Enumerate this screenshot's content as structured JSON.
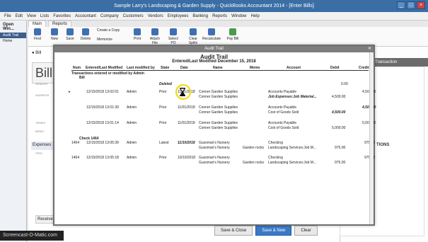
{
  "window": {
    "title": "Sample Larry's Landscaping & Garden Supply  - QuickBooks Accountant 2014 - [Enter Bills]"
  },
  "menu": [
    "File",
    "Edit",
    "View",
    "Lists",
    "Favorites",
    "Accountant",
    "Company",
    "Customers",
    "Vendors",
    "Employees",
    "Banking",
    "Reports",
    "Window",
    "Help"
  ],
  "leftnav": {
    "header": "Open Win...",
    "items": [
      "Audit Trail",
      "Home"
    ]
  },
  "tabs": [
    "Main",
    "Reports"
  ],
  "toolbar": [
    "Find",
    "New",
    "Save",
    "Delete",
    "Create a Copy",
    "Memorize",
    "Print",
    "Attach File",
    "Select PO",
    "Clear Splits",
    "Recalculate",
    "Pay Bill"
  ],
  "form": {
    "type_label": "Bill",
    "title": "Bill",
    "labels": [
      "VENDOR",
      "ADDRESS",
      "TERMS",
      "MEMO"
    ],
    "expenses_tab": "Expenses",
    "item_label": "ITEM",
    "receive_btn": "Receive"
  },
  "rightpanel": {
    "header": "Transaction",
    "label": "TIONS"
  },
  "bottom": {
    "save_close": "Save & Close",
    "save_new": "Save & New",
    "clear": "Clear"
  },
  "watermark": "Screencast-O-Matic.com",
  "dialog": {
    "title": "Audit Trail",
    "report_title": "Entered/Last Modified December 15, 2018",
    "columns": [
      "Num",
      "Entered/Last Modified",
      "Last modified by",
      "State",
      "Date",
      "Name",
      "Memo",
      "Account",
      "Debit",
      "Credit"
    ],
    "section": "Transactions entered or modified by Admin",
    "subsection": "Bill",
    "deleted_label": "Deleted",
    "deleted_debit": "0.00",
    "rows": [
      {
        "arrow": "▸",
        "num": "",
        "entered": "12/15/2018 13:02:01",
        "by": "Admin",
        "state": "Prior",
        "date": "11/01/2018",
        "names": [
          "Conner Garden Supplies",
          "Conner Garden Supplies"
        ],
        "memo": [
          "",
          ""
        ],
        "accounts": [
          "Accounts Payable",
          "Job Expenses:Job Material..."
        ],
        "debits": [
          "",
          "4,500.00"
        ],
        "credits": [
          "4,500.00",
          ""
        ]
      },
      {
        "arrow": "",
        "num": "",
        "entered": "12/15/2018 13:01:39",
        "by": "Admin",
        "state": "Prior",
        "date": "11/01/2018",
        "names": [
          "Conner Garden Supplies",
          "Conner Garden Supplies"
        ],
        "memo": [
          "",
          ""
        ],
        "accounts": [
          "Accounts Payable",
          "Cost of Goods Sold"
        ],
        "debits": [
          "",
          "4,500.00"
        ],
        "credits": [
          "4,500.00",
          ""
        ]
      },
      {
        "arrow": "",
        "num": "",
        "entered": "12/15/2018 13:01:14",
        "by": "Admin",
        "state": "Prior",
        "date": "11/01/2018",
        "names": [
          "Conner Garden Supplies",
          "Conner Garden Supplies"
        ],
        "memo": [
          "",
          ""
        ],
        "accounts": [
          "Accounts Payable",
          "Cost of Goods Sold"
        ],
        "debits": [
          "",
          "5,000.00"
        ],
        "credits": [
          "5,000.00",
          ""
        ]
      }
    ],
    "check_label": "Check 1464",
    "checks": [
      {
        "num": "1464",
        "entered": "12/15/2018 13:05:39",
        "by": "Admin",
        "state": "Latest",
        "date": "11/10/2018",
        "names": [
          "Gussman's Nursery",
          "Gussman's Nursery"
        ],
        "memo": [
          "",
          "Garden rocks"
        ],
        "accounts": [
          "Checking",
          "Landscaping Services:Job M..."
        ],
        "debits": [
          "",
          "975.00"
        ],
        "credits": [
          "975.00",
          ""
        ]
      },
      {
        "num": "1464",
        "entered": "12/15/2018 13:05:18",
        "by": "Admin",
        "state": "Prior",
        "date": "10/10/2018",
        "names": [
          "Gussman's Nursery",
          "Gussman's Nursery"
        ],
        "memo": [
          "",
          "Garden rocks"
        ],
        "accounts": [
          "Checking",
          "Landscaping Services:Job M..."
        ],
        "debits": [
          "",
          "975.00"
        ],
        "credits": [
          "975.00",
          ""
        ]
      }
    ]
  }
}
